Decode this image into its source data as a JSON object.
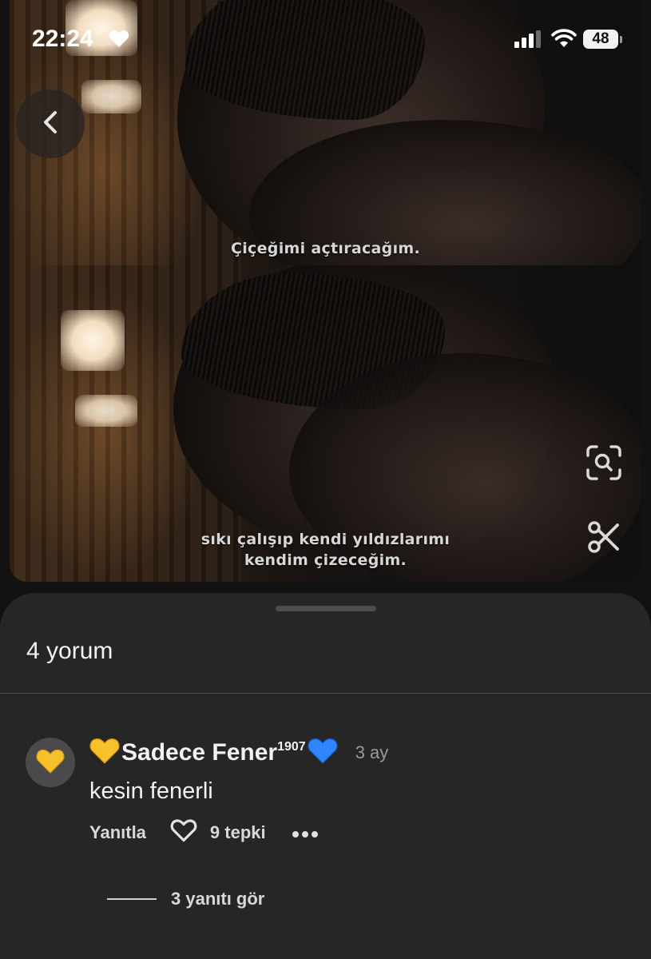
{
  "status_bar": {
    "time": "22:24",
    "battery": "48",
    "icons": [
      "heart-icon",
      "signal-icon",
      "wifi-icon",
      "battery-icon"
    ]
  },
  "media": {
    "subtitle_top": "Çiçeğimi açtıracağım.",
    "subtitle_bottom_line1": "sıkı çalışıp kendi yıldızlarımı",
    "subtitle_bottom_line2": "kendim çizeceğim.",
    "icons": [
      "back-chevron-icon",
      "visual-search-icon",
      "scissors-icon"
    ]
  },
  "comments": {
    "count_label": "4 yorum",
    "items": [
      {
        "avatar_emoji": "💛",
        "name_prefix_emoji": "💛",
        "username": "Sadece Fener",
        "username_superscript": "1907",
        "name_suffix_emoji": "💙",
        "timestamp": "3 ay",
        "text": "kesin fenerli",
        "reply_label": "Yanıtla",
        "reactions_label": "9 tepki",
        "view_replies_label": "3 yanıtı gör"
      }
    ]
  },
  "colors": {
    "sheet_background": "#262626",
    "text_primary": "#f2f2f2",
    "text_secondary": "#9a9a9a"
  }
}
